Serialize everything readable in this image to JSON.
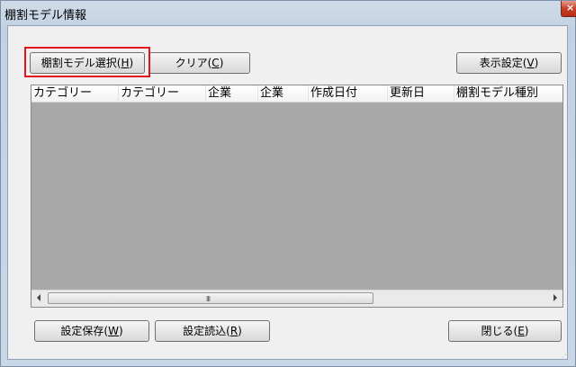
{
  "window": {
    "title": "棚割モデル情報",
    "close_glyph": "×"
  },
  "toolbar": {
    "select_model_label": "棚割モデル選択(",
    "select_model_key": "H",
    "clear_label": "クリア(",
    "clear_key": "C",
    "display_settings_label": "表示設定(",
    "display_settings_key": "V"
  },
  "table": {
    "columns": [
      "カテゴリー",
      "カテゴリー",
      "企業",
      "企業",
      "作成日付",
      "更新日",
      "棚割モデル種別"
    ],
    "rows": []
  },
  "scrollbar": {
    "grip": "III"
  },
  "footer": {
    "save_settings_label": "設定保存(",
    "save_settings_key": "W",
    "load_settings_label": "設定読込(",
    "load_settings_key": "R",
    "close_label": "閉じる(",
    "close_key": "E"
  },
  "colors": {
    "highlight": "#e2141b",
    "list_background": "#a9a9a9",
    "close_button": "#c9402a"
  }
}
